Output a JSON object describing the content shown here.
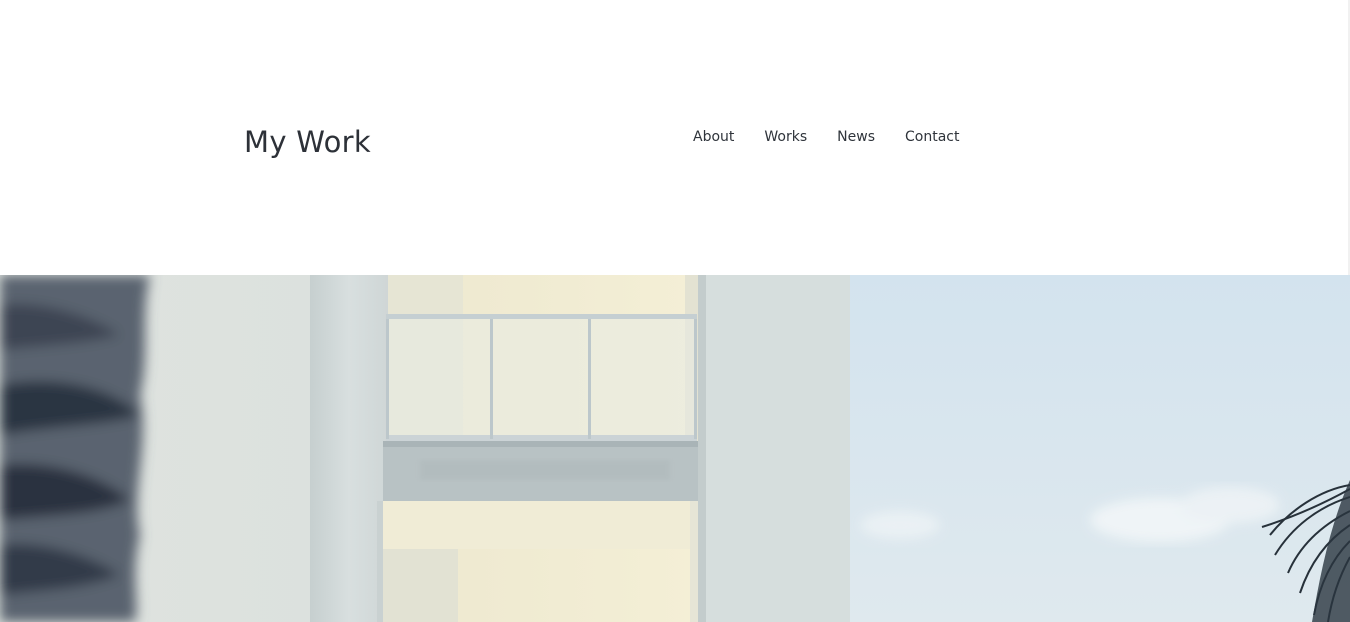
{
  "site": {
    "title": "My Work"
  },
  "nav": {
    "items": [
      {
        "label": "About"
      },
      {
        "label": "Works"
      },
      {
        "label": "News"
      },
      {
        "label": "Contact"
      }
    ]
  },
  "hero": {
    "subject": "white building balcony with palm tree against sky",
    "colors": {
      "sky": "#d5e4ec",
      "wall": "#dfe5e6",
      "wall_shadow": "#b9c3c5",
      "warm_interior": "#f1ead0",
      "palm_dark": "#2c3442"
    }
  }
}
